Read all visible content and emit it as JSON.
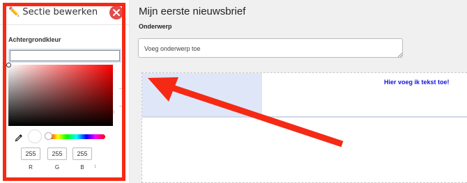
{
  "panel": {
    "title": "✏️ Sectie bewerken",
    "close_icon": "close-x-icon",
    "background_label": "Achtergrondkleur",
    "color_value": ""
  },
  "picker": {
    "hue_color": "#ff0000",
    "selected_color": "#ffffff",
    "r": "255",
    "g": "255",
    "b": "255",
    "r_label": "R",
    "g_label": "G",
    "b_label": "B",
    "toggle_icon": "up-down-arrows-icon",
    "eyedropper_icon": "eyedropper-icon"
  },
  "main": {
    "title": "Mijn eerste nieuwsbrief",
    "subject_label": "Onderwerp",
    "subject_placeholder": "Voeg onderwerp toe",
    "text_block": "Hier voeg ik tekst toe!"
  },
  "annotation": {
    "frame_color": "#f52a15",
    "arrow_color": "#f52a15"
  }
}
